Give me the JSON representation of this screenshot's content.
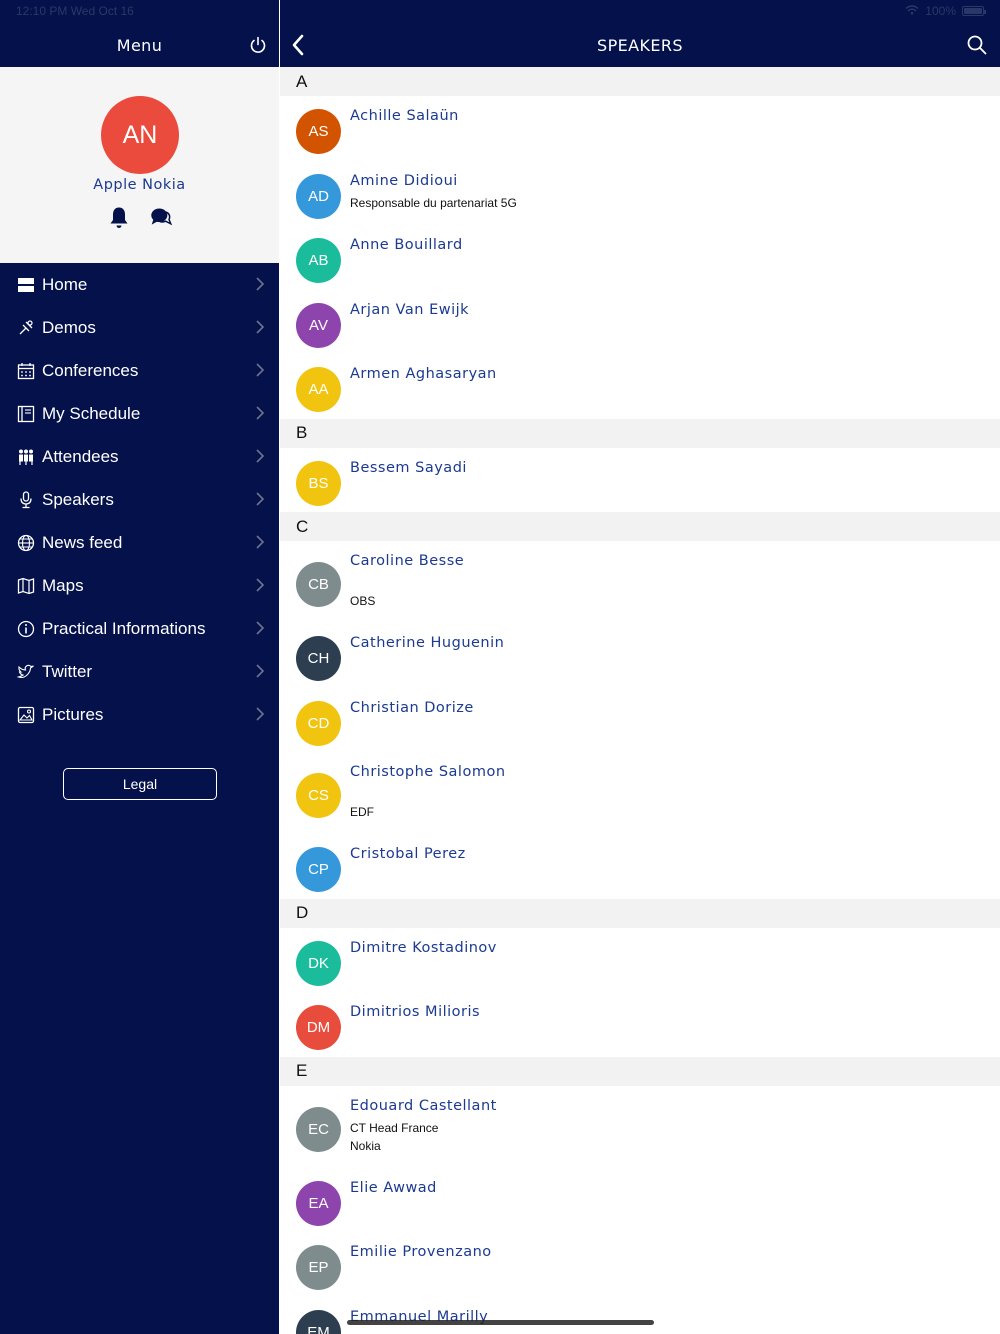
{
  "status": {
    "time": "12:10 PM  Wed Oct 16",
    "battery": "100%",
    "battery_level": 1.0
  },
  "sidebar": {
    "title": "Menu",
    "profile": {
      "initials": "AN",
      "name": "Apple Nokia",
      "avatar_color": "#ea4b3c"
    },
    "items": [
      {
        "label": "Home",
        "icon": "home-icon"
      },
      {
        "label": "Demos",
        "icon": "demos-icon"
      },
      {
        "label": "Conferences",
        "icon": "calendar-icon"
      },
      {
        "label": "My Schedule",
        "icon": "schedule-icon"
      },
      {
        "label": "Attendees",
        "icon": "attendees-icon"
      },
      {
        "label": "Speakers",
        "icon": "microphone-icon"
      },
      {
        "label": "News feed",
        "icon": "globe-icon"
      },
      {
        "label": "Maps",
        "icon": "map-icon"
      },
      {
        "label": "Practical Informations",
        "icon": "info-icon"
      },
      {
        "label": "Twitter",
        "icon": "twitter-icon"
      },
      {
        "label": "Pictures",
        "icon": "pictures-icon"
      }
    ],
    "legal_label": "Legal"
  },
  "main": {
    "title": "SPEAKERS",
    "sections": [
      {
        "letter": "A",
        "speakers": [
          {
            "initials": "AS",
            "name": "Achille Salaün",
            "color": "#d35400"
          },
          {
            "initials": "AD",
            "name": "Amine Didioui",
            "subtitle": "Responsable du partenariat 5G",
            "color": "#3498db"
          },
          {
            "initials": "AB",
            "name": "Anne Bouillard",
            "color": "#1abc9c"
          },
          {
            "initials": "AV",
            "name": "Arjan Van Ewijk",
            "color": "#8e44ad"
          },
          {
            "initials": "AA",
            "name": "Armen Aghasaryan",
            "color": "#f1c40f"
          }
        ]
      },
      {
        "letter": "B",
        "speakers": [
          {
            "initials": "BS",
            "name": "Bessem Sayadi",
            "color": "#f1c40f"
          }
        ]
      },
      {
        "letter": "C",
        "speakers": [
          {
            "initials": "CB",
            "name": "Caroline Besse",
            "subtitle": "OBS",
            "color": "#7f8c8d"
          },
          {
            "initials": "CH",
            "name": "Catherine Huguenin",
            "color": "#2c3e50"
          },
          {
            "initials": "CD",
            "name": "Christian Dorize",
            "color": "#f1c40f"
          },
          {
            "initials": "CS",
            "name": "Christophe Salomon",
            "subtitle": "EDF",
            "color": "#f1c40f"
          },
          {
            "initials": "CP",
            "name": "Cristobal Perez",
            "color": "#3498db"
          }
        ]
      },
      {
        "letter": "D",
        "speakers": [
          {
            "initials": "DK",
            "name": "Dimitre Kostadinov",
            "color": "#1abc9c"
          },
          {
            "initials": "DM",
            "name": "Dimitrios Milioris",
            "color": "#e74c3c"
          }
        ]
      },
      {
        "letter": "E",
        "speakers": [
          {
            "initials": "EC",
            "name": "Edouard Castellant",
            "subtitle": "CT Head France",
            "subtitle2": "Nokia",
            "color": "#7f8c8d"
          },
          {
            "initials": "EA",
            "name": "Elie Awwad",
            "color": "#8e44ad"
          },
          {
            "initials": "EP",
            "name": "Emilie Provenzano",
            "color": "#7f8c8d"
          },
          {
            "initials": "EM",
            "name": "Emmanuel Marilly",
            "color": "#2c3e50"
          }
        ]
      }
    ]
  }
}
